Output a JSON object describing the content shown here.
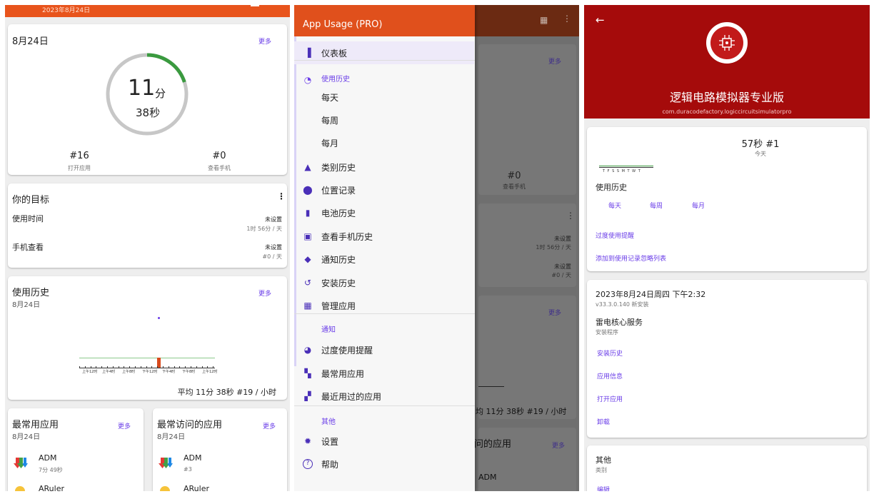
{
  "screen1": {
    "topbar_date": "2023年8月24日",
    "today_card": {
      "date": "8月24日",
      "more": "更多",
      "minutes": "11",
      "min_unit": "分",
      "seconds": "38秒",
      "ring_fraction": 0.2,
      "open_count": "#16",
      "open_label": "打开应用",
      "check_count": "#0",
      "check_label": "查看手机"
    },
    "goals_card": {
      "title": "你的目标",
      "menu_icon": "more-vert-icon",
      "rows": [
        {
          "label": "使用时间",
          "status": "未设置",
          "detail": "1时 56分 / 天"
        },
        {
          "label": "手机查看",
          "status": "未设置",
          "detail": "#0 / 天"
        }
      ]
    },
    "history_card": {
      "title": "使用历史",
      "date": "8月24日",
      "more": "更多",
      "tick_labels": [
        "上午12时",
        "上午4时",
        "上午8时",
        "下午12时",
        "下午4时",
        "下午8时",
        "上午12时"
      ],
      "summary": "平均 11分 38秒 #19 / 小时"
    },
    "most_used": {
      "title": "最常用应用",
      "more": "更多",
      "date": "8月24日",
      "items": [
        {
          "name": "ADM",
          "detail": "7分 49秒",
          "icon": "adm-icon"
        },
        {
          "name": "ARuler",
          "detail": "",
          "icon": "aruler-icon"
        }
      ]
    },
    "most_visited": {
      "title": "最常访问的应用",
      "more": "更多",
      "date": "8月24日",
      "items": [
        {
          "name": "ADM",
          "detail": "#3",
          "icon": "adm-icon"
        },
        {
          "name": "ARuler",
          "detail": "",
          "icon": "aruler-icon"
        }
      ]
    }
  },
  "screen2": {
    "drawer_title": "App Usage (PRO)",
    "items": [
      {
        "label": "仪表板",
        "icon": "bar-chart-icon",
        "active": true
      },
      {
        "label": "使用历史",
        "icon": "pie-icon",
        "section": true
      },
      {
        "label": "每天",
        "icon": ""
      },
      {
        "label": "每周",
        "icon": ""
      },
      {
        "label": "每月",
        "icon": ""
      },
      {
        "label": "类别历史",
        "icon": "category-icon"
      },
      {
        "label": "位置记录",
        "icon": "location-pin-icon"
      },
      {
        "label": "电池历史",
        "icon": "battery-icon"
      },
      {
        "label": "查看手机历史",
        "icon": "phone-check-icon"
      },
      {
        "label": "通知历史",
        "icon": "bell-icon"
      },
      {
        "label": "安装历史",
        "icon": "history-icon"
      },
      {
        "label": "管理应用",
        "icon": "grid-icon"
      }
    ],
    "section_notify": "通知",
    "notify_items": [
      {
        "label": "过度使用提醒",
        "icon": "half-circle-icon"
      },
      {
        "label": "最常用应用",
        "icon": "dashboard-icon"
      },
      {
        "label": "最近用过的应用",
        "icon": "recent-apps-icon"
      }
    ],
    "section_other": "其他",
    "other_items": [
      {
        "label": "设置",
        "icon": "gear-icon"
      },
      {
        "label": "帮助",
        "icon": "help-icon"
      }
    ],
    "behind": {
      "more1": "更多",
      "check_count": "#0",
      "check_label": "查看手机",
      "status1": "未设置",
      "detail1": "1时 56分 / 天",
      "status2": "未设置",
      "detail2": "#0 / 天",
      "more2": "更多",
      "summary": "均 11分 38秒 #19 / 小时",
      "visited_title": "问的应用",
      "more3": "更多",
      "adm": "ADM"
    }
  },
  "screen3": {
    "app_name": "逻辑电路模拟器专业版",
    "package": "com.duracodefactory.logiccircuitsimulatorpro",
    "header_color": "#a50b0b",
    "today": {
      "value": "57秒 #1",
      "label": "今天",
      "days": "T F S S M T W T"
    },
    "history_title": "使用历史",
    "history_links": [
      "每天",
      "每周",
      "每月"
    ],
    "links": [
      "过度使用提醒",
      "添加到使用记录忽略列表"
    ],
    "install": {
      "datetime": "2023年8月24日周四 下午2:32",
      "version": "v33.3.0.140 新安装",
      "service": "雷电核心服务",
      "service_sub": "安装程序",
      "links": [
        "安装历史",
        "应用信息",
        "打开应用",
        "卸载"
      ]
    },
    "category": {
      "title": "其他",
      "sub": "类别",
      "edit": "编辑"
    }
  }
}
